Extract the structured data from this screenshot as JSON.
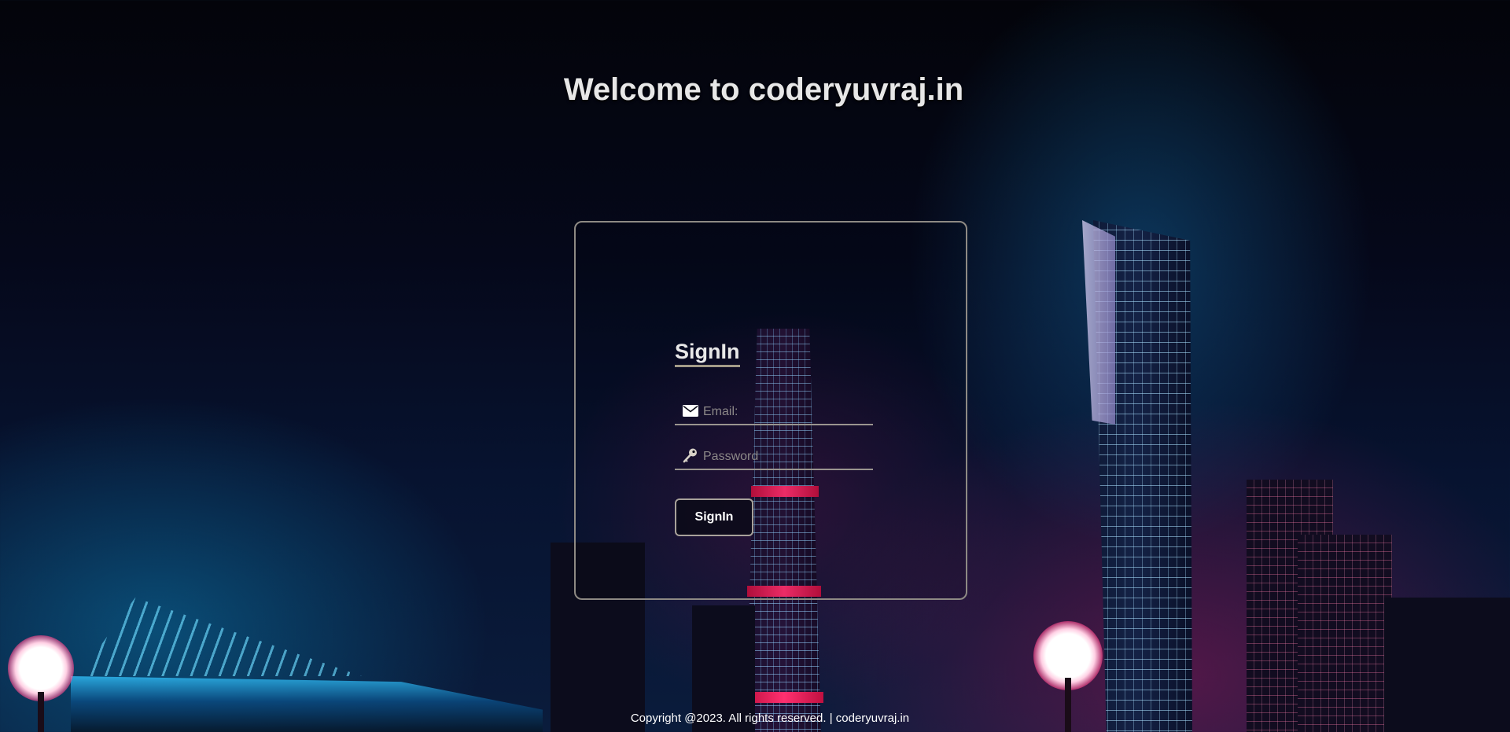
{
  "header": {
    "title": "Welcome to coderyuvraj.in"
  },
  "signin_form": {
    "title": "SignIn",
    "email": {
      "placeholder": "Email:",
      "value": "",
      "icon": "envelope-icon"
    },
    "password": {
      "placeholder": "Password",
      "value": "",
      "icon": "key-icon"
    },
    "submit_label": "SignIn"
  },
  "footer": {
    "text": "Copyright @2023. All rights reserved. | coderyuvraj.in"
  },
  "colors": {
    "panel_border": "#8e8a84",
    "text": "#e8e8e8",
    "placeholder": "#8c8888",
    "underline": "#9a958f"
  }
}
